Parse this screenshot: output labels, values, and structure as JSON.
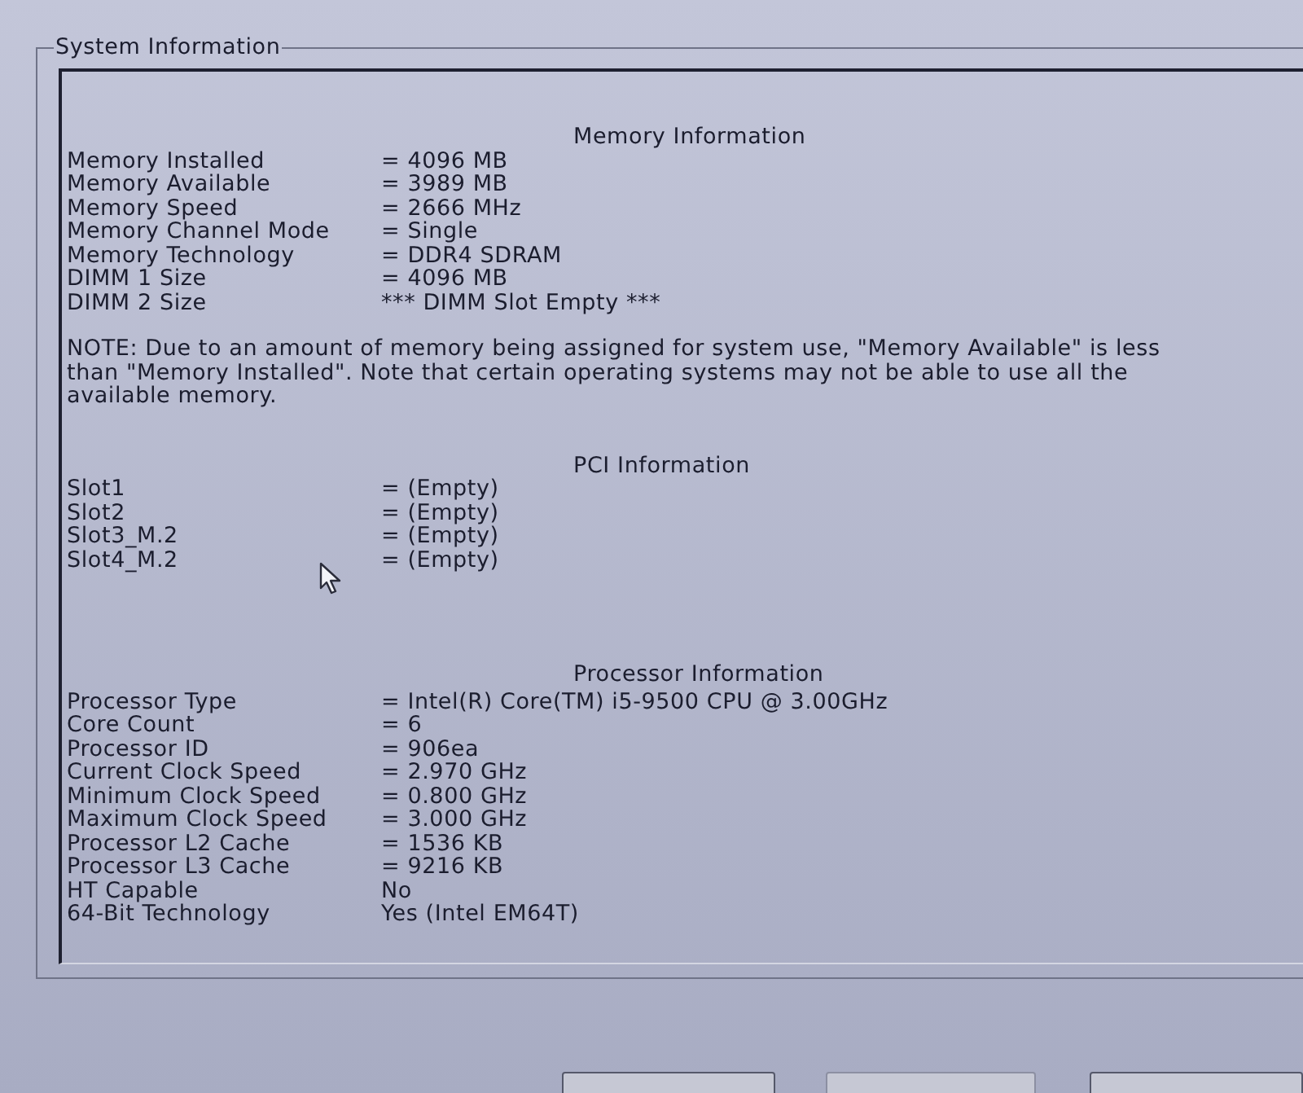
{
  "group": {
    "title": "System Information"
  },
  "sections": [
    {
      "heading": "Memory Information",
      "rows": [
        {
          "label": "Memory Installed",
          "value": "= 4096 MB"
        },
        {
          "label": "Memory Available",
          "value": "= 3989 MB"
        },
        {
          "label": "Memory Speed",
          "value": "= 2666 MHz"
        },
        {
          "label": "Memory Channel Mode",
          "value": "= Single"
        },
        {
          "label": "Memory Technology",
          "value": "= DDR4 SDRAM"
        },
        {
          "label": "DIMM 1 Size",
          "value": "= 4096 MB"
        },
        {
          "label": "DIMM 2 Size",
          "value": "*** DIMM Slot Empty ***"
        }
      ],
      "note": "NOTE: Due to an amount of memory being assigned for system use, \"Memory Available\" is less than \"Memory Installed\". Note that certain operating systems may not be able to use all the available memory."
    },
    {
      "heading": "PCI Information",
      "rows": [
        {
          "label": "Slot1",
          "value": "= (Empty)"
        },
        {
          "label": "Slot2",
          "value": "= (Empty)"
        },
        {
          "label": "Slot3_M.2",
          "value": "= (Empty)"
        },
        {
          "label": "Slot4_M.2",
          "value": "= (Empty)"
        }
      ]
    },
    {
      "heading": "Processor Information",
      "rows": [
        {
          "label": "Processor Type",
          "value": "= Intel(R) Core(TM) i5-9500 CPU @ 3.00GHz"
        },
        {
          "label": "Core Count",
          "value": "= 6"
        },
        {
          "label": "Processor ID",
          "value": "= 906ea"
        },
        {
          "label": "Current Clock Speed",
          "value": "= 2.970 GHz"
        },
        {
          "label": "Minimum Clock Speed",
          "value": "= 0.800 GHz"
        },
        {
          "label": "Maximum Clock Speed",
          "value": "= 3.000 GHz"
        },
        {
          "label": "Processor L2 Cache",
          "value": "= 1536 KB"
        },
        {
          "label": "Processor L3 Cache",
          "value": "= 9216 KB"
        },
        {
          "label": "HT Capable",
          "value": "No"
        },
        {
          "label": "64-Bit Technology",
          "value": "Yes (Intel EM64T)"
        }
      ]
    }
  ]
}
